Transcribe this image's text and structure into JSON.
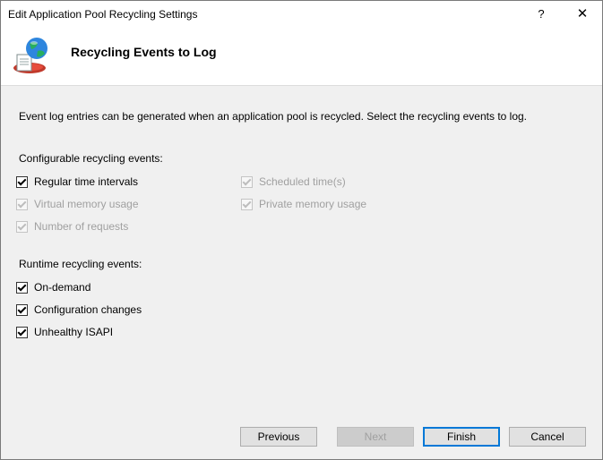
{
  "window": {
    "title": "Edit Application Pool Recycling Settings"
  },
  "titlebar": {
    "help": "?",
    "close": "✕"
  },
  "header": {
    "title": "Recycling Events to Log",
    "icon": "globe-app-pool-icon"
  },
  "description": "Event log entries can be generated when an application pool is recycled. Select the recycling events to log.",
  "configurable": {
    "label": "Configurable recycling events:",
    "items": [
      {
        "label": "Regular time intervals",
        "checked": true,
        "enabled": true
      },
      {
        "label": "Virtual memory usage",
        "checked": true,
        "enabled": false
      },
      {
        "label": "Number of requests",
        "checked": true,
        "enabled": false
      },
      {
        "label": "Scheduled time(s)",
        "checked": true,
        "enabled": false
      },
      {
        "label": "Private memory usage",
        "checked": true,
        "enabled": false
      }
    ]
  },
  "runtime": {
    "label": "Runtime recycling events:",
    "items": [
      {
        "label": "On-demand",
        "checked": true,
        "enabled": true
      },
      {
        "label": "Configuration changes",
        "checked": true,
        "enabled": true
      },
      {
        "label": "Unhealthy ISAPI",
        "checked": true,
        "enabled": true
      }
    ]
  },
  "buttons": {
    "previous": "Previous",
    "next": "Next",
    "finish": "Finish",
    "cancel": "Cancel"
  }
}
